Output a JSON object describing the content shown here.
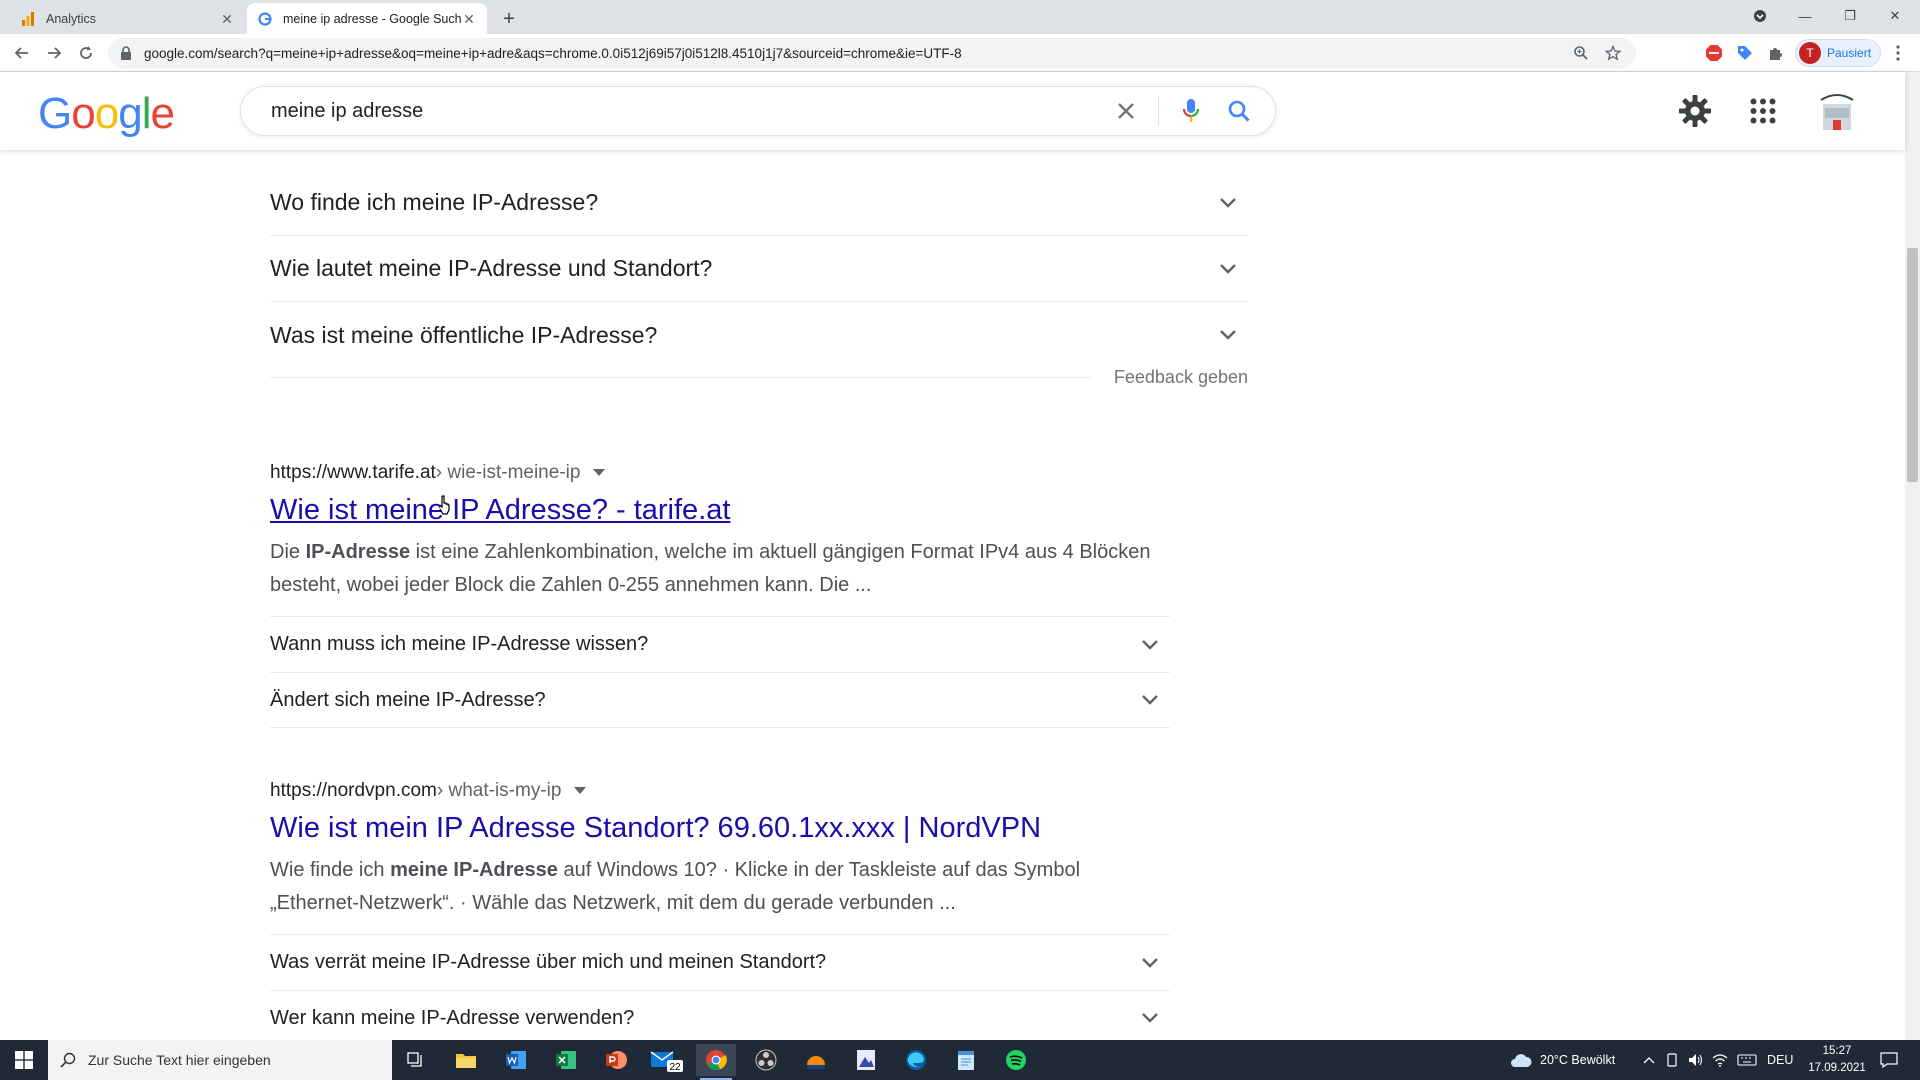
{
  "browser": {
    "tabs": [
      {
        "title": "Analytics",
        "active": false
      },
      {
        "title": "meine ip adresse - Google Suche",
        "active": true
      }
    ],
    "url": "google.com/search?q=meine+ip+adresse&oq=meine+ip+adre&aqs=chrome.0.0i512j69i57j0i512l8.4510j1j7&sourceid=chrome&ie=UTF-8",
    "profile_label": "Pausiert",
    "profile_initial": "T"
  },
  "google": {
    "logo_letters": [
      "G",
      "o",
      "o",
      "g",
      "l",
      "e"
    ],
    "logo_colors": [
      "#4285f4",
      "#ea4335",
      "#fbbc05",
      "#4285f4",
      "#34a853",
      "#ea4335"
    ],
    "query": "meine ip adresse"
  },
  "people_also_ask": [
    "Wo finde ich meine IP-Adresse?",
    "Wie lautet meine IP-Adresse und Standort?",
    "Was ist meine öffentliche IP-Adresse?"
  ],
  "feedback_label": "Feedback geben",
  "results": [
    {
      "site": "https://www.tarife.at",
      "path": " › wie-ist-meine-ip",
      "title": "Wie ist meine IP Adresse? - tarife.at",
      "snippet_parts": [
        "Die ",
        "IP-Adresse",
        " ist eine Zahlenkombination, welche im aktuell gängigen Format IPv4 aus 4 Blöcken besteht, wobei jeder Block die Zahlen 0-255 annehmen kann. Die ..."
      ],
      "sub_questions": [
        "Wann muss ich meine IP-Adresse wissen?",
        "Ändert sich meine IP-Adresse?"
      ]
    },
    {
      "site": "https://nordvpn.com",
      "path": " › what-is-my-ip",
      "title": "Wie ist mein IP Adresse Standort? 69.60.1xx.xxx | NordVPN",
      "snippet_parts": [
        "Wie finde ich ",
        "meine IP-Adresse",
        " auf Windows 10? · Klicke in der Taskleiste auf das Symbol „Ethernet-Netzwerk“. · Wähle das Netzwerk, mit dem du gerade verbunden ..."
      ],
      "sub_questions": [
        "Was verrät meine IP-Adresse über mich und meinen Standort?",
        "Wer kann meine IP-Adresse verwenden?"
      ]
    }
  ],
  "taskbar": {
    "search_placeholder": "Zur Suche Text hier eingeben",
    "mail_badge": "22",
    "weather": "20°C  Bewölkt",
    "language": "DEU",
    "time": "15:27",
    "date": "17.09.2021"
  },
  "icons": {
    "tab_analytics": "analytics-bars-icon",
    "tab_google": "google-g-icon",
    "search_clear": "close-icon",
    "voice": "microphone-icon",
    "search": "search-icon",
    "settings": "gear-icon",
    "apps": "apps-grid-icon",
    "expand": "chevron-down-icon"
  }
}
